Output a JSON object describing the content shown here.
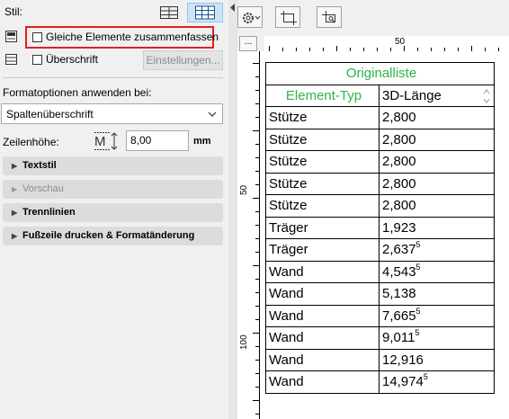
{
  "left_panel": {
    "stil_label": "Stil:",
    "gleiche_label": "Gleiche Elemente zusammenfassen",
    "ueberschrift_label": "Überschrift",
    "einstellungen_button": "Einstellungen...",
    "formatoptionen_label": "Formatoptionen anwenden bei:",
    "format_dropdown_value": "Spaltenüberschrift",
    "zeilenhoehe_label": "Zeilenhöhe:",
    "zeilenhoehe_value": "8,00",
    "zeilenhoehe_unit": "mm",
    "sections": [
      {
        "label": "Textstil",
        "enabled": true
      },
      {
        "label": "Vorschau",
        "enabled": false
      },
      {
        "label": "Trennlinien",
        "enabled": true
      },
      {
        "label": "Fußzeile drucken & Formatänderung",
        "enabled": true
      }
    ]
  },
  "toolbar": {
    "options_icon": "gear-icon",
    "ellipsis_label": "..."
  },
  "ruler": {
    "h_label": "50",
    "v_labels": [
      "50",
      "100"
    ]
  },
  "schedule": {
    "title": "Originalliste",
    "headers": [
      "Element-Typ",
      "3D-Länge"
    ],
    "rows": [
      {
        "type": "Stütze",
        "value": "2,800",
        "sup": ""
      },
      {
        "type": "Stütze",
        "value": "2,800",
        "sup": ""
      },
      {
        "type": "Stütze",
        "value": "2,800",
        "sup": ""
      },
      {
        "type": "Stütze",
        "value": "2,800",
        "sup": ""
      },
      {
        "type": "Stütze",
        "value": "2,800",
        "sup": ""
      },
      {
        "type": "Träger",
        "value": "1,923",
        "sup": ""
      },
      {
        "type": "Träger",
        "value": "2,637",
        "sup": "5"
      },
      {
        "type": "Wand",
        "value": "4,543",
        "sup": "5"
      },
      {
        "type": "Wand",
        "value": "5,138",
        "sup": ""
      },
      {
        "type": "Wand",
        "value": "7,665",
        "sup": "5"
      },
      {
        "type": "Wand",
        "value": "9,011",
        "sup": "5"
      },
      {
        "type": "Wand",
        "value": "12,916",
        "sup": ""
      },
      {
        "type": "Wand",
        "value": "14,974",
        "sup": "5"
      }
    ]
  },
  "colors": {
    "header_green": "#2db34a",
    "highlight_red": "#e02020",
    "active_button": "#cde3f7"
  }
}
